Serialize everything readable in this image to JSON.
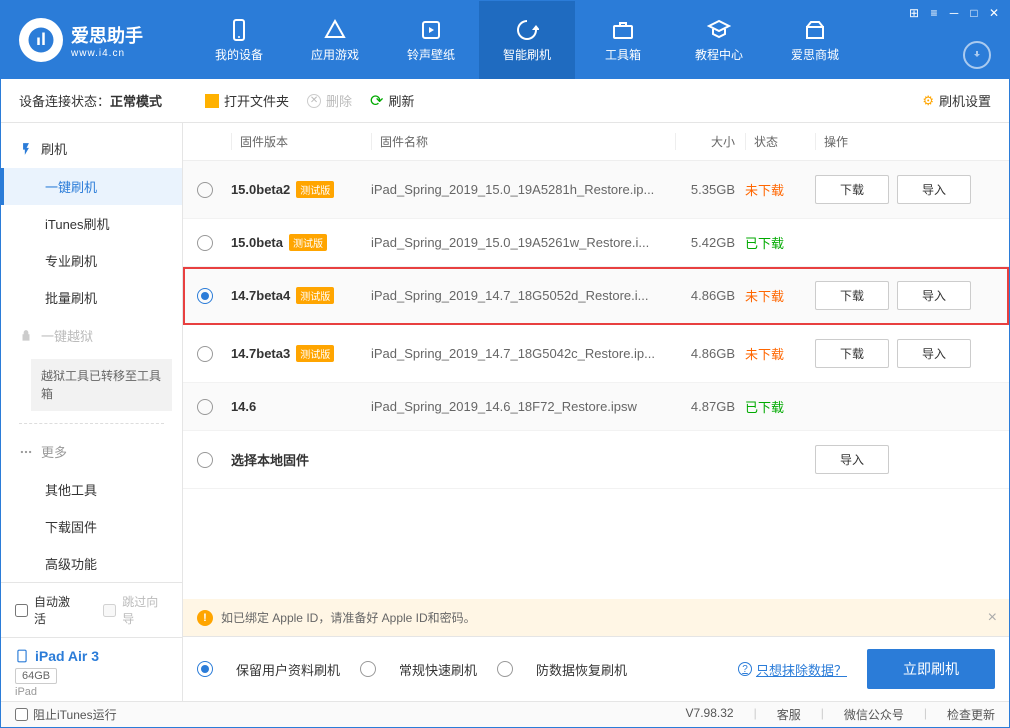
{
  "logo": {
    "title": "爱思助手",
    "url": "www.i4.cn"
  },
  "nav": [
    {
      "label": "我的设备"
    },
    {
      "label": "应用游戏"
    },
    {
      "label": "铃声壁纸"
    },
    {
      "label": "智能刷机",
      "active": true
    },
    {
      "label": "工具箱"
    },
    {
      "label": "教程中心"
    },
    {
      "label": "爱思商城"
    }
  ],
  "conn": {
    "label": "设备连接状态：",
    "value": "正常模式"
  },
  "toolbar": {
    "open": "打开文件夹",
    "delete": "删除",
    "refresh": "刷新",
    "settings": "刷机设置"
  },
  "sidebar": {
    "flash": {
      "head": "刷机",
      "items": [
        "一键刷机",
        "iTunes刷机",
        "专业刷机",
        "批量刷机"
      ]
    },
    "jailbreak": {
      "head": "一键越狱",
      "note": "越狱工具已转移至工具箱"
    },
    "more": {
      "head": "更多",
      "items": [
        "其他工具",
        "下载固件",
        "高级功能"
      ]
    },
    "auto_activate": "自动激活",
    "skip_guide": "跳过向导",
    "device": {
      "name": "iPad Air 3",
      "storage": "64GB",
      "type": "iPad"
    }
  },
  "columns": {
    "version": "固件版本",
    "name": "固件名称",
    "size": "大小",
    "status": "状态",
    "ops": "操作"
  },
  "firmware": [
    {
      "ver": "15.0beta2",
      "beta": "测试版",
      "name": "iPad_Spring_2019_15.0_19A5281h_Restore.ip...",
      "size": "5.35GB",
      "status": "未下载",
      "status_cls": "not",
      "dl": true,
      "im": true,
      "checked": false
    },
    {
      "ver": "15.0beta",
      "beta": "测试版",
      "name": "iPad_Spring_2019_15.0_19A5261w_Restore.i...",
      "size": "5.42GB",
      "status": "已下载",
      "status_cls": "done",
      "dl": false,
      "im": false,
      "checked": false
    },
    {
      "ver": "14.7beta4",
      "beta": "测试版",
      "name": "iPad_Spring_2019_14.7_18G5052d_Restore.i...",
      "size": "4.86GB",
      "status": "未下载",
      "status_cls": "not",
      "dl": true,
      "im": true,
      "checked": true,
      "highlight": true
    },
    {
      "ver": "14.7beta3",
      "beta": "测试版",
      "name": "iPad_Spring_2019_14.7_18G5042c_Restore.ip...",
      "size": "4.86GB",
      "status": "未下载",
      "status_cls": "not",
      "dl": true,
      "im": true,
      "checked": false
    },
    {
      "ver": "14.6",
      "beta": "",
      "name": "iPad_Spring_2019_14.6_18F72_Restore.ipsw",
      "size": "4.87GB",
      "status": "已下载",
      "status_cls": "done",
      "dl": false,
      "im": false,
      "checked": false
    },
    {
      "ver": "选择本地固件",
      "beta": "",
      "name": "",
      "size": "",
      "status": "",
      "status_cls": "",
      "dl": false,
      "im": true,
      "checked": false,
      "local": true
    }
  ],
  "buttons": {
    "download": "下载",
    "import": "导入"
  },
  "warning": "如已绑定 Apple ID，请准备好 Apple ID和密码。",
  "flash_opts": {
    "keep": "保留用户资料刷机",
    "normal": "常规快速刷机",
    "recover": "防数据恢复刷机",
    "erase_link": "只想抹除数据？",
    "flash_now": "立即刷机"
  },
  "statusbar": {
    "block_itunes": "阻止iTunes运行",
    "version": "V7.98.32",
    "service": "客服",
    "wechat": "微信公众号",
    "update": "检查更新"
  }
}
